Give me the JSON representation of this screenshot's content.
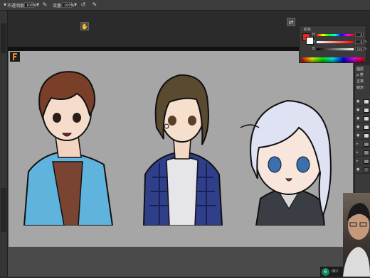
{
  "options_bar": {
    "opacity_label": "不透明度:",
    "opacity_value": "100%",
    "flow_label": "流量:",
    "flow_value": "100%"
  },
  "color_panel": {
    "title": "颜色",
    "channels": [
      {
        "label": "H",
        "value": "0"
      },
      {
        "label": "S",
        "value": "0"
      },
      {
        "label": "B",
        "value": "100"
      }
    ],
    "percent": "%",
    "foreground_color": "#e8281e",
    "background_color": "#ffffff"
  },
  "layers_panel": {
    "tab_label": "图层",
    "kind_label": "ρ 类",
    "blend_label": "正常",
    "lock_label": "锁定:"
  },
  "taskbar": {
    "badge": "6",
    "text": "dcr"
  }
}
